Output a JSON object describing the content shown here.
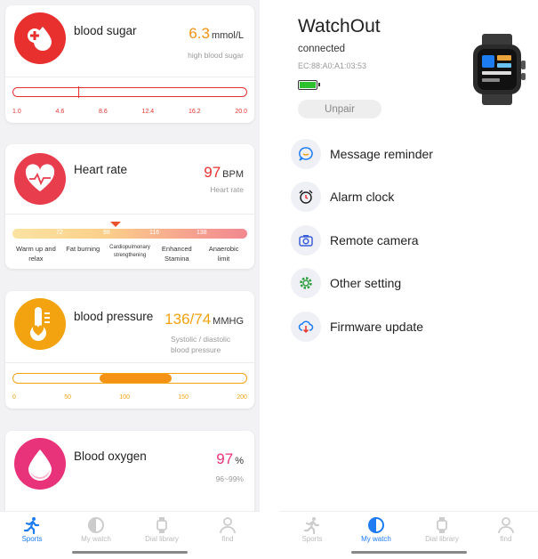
{
  "colors": {
    "sugar": "#e8312f",
    "heart": "#e83d4c",
    "pressure": "#f3a210",
    "oxygen": "#e8337a",
    "accent_blue": "#1e7cf2"
  },
  "left": {
    "blood_sugar": {
      "title": "blood sugar",
      "value": "6.3",
      "unit": "mmol/L",
      "status": "high blood sugar",
      "marker_fraction": 0.28,
      "ticks": [
        "1.0",
        "4.6",
        "8.6",
        "12.4",
        "16.2",
        "20.0"
      ]
    },
    "heart_rate": {
      "title": "Heart rate",
      "value": "97",
      "unit": "BPM",
      "sub": "Heart rate",
      "marker_fraction": 0.44,
      "scale_values": [
        "72",
        "98",
        "116",
        "138"
      ],
      "zones": [
        "Warm up and relax",
        "Fat burning",
        "Cardiopulmonary strengthening",
        "Enhanced Stamina",
        "Anaerobic limit"
      ]
    },
    "blood_pressure": {
      "title": "blood pressure",
      "value": "136/74",
      "unit": "MMHG",
      "sub_line1": "Systolic / diastolic",
      "sub_line2": "blood pressure",
      "range": [
        74,
        136
      ],
      "axis_max": 200,
      "ticks": [
        "0",
        "50",
        "100",
        "150",
        "200"
      ]
    },
    "blood_oxygen": {
      "title": "Blood oxygen",
      "value": "97",
      "unit": "%",
      "sub": "96~99%"
    },
    "tabs": [
      {
        "label": "Sports",
        "icon": "running-person-icon"
      },
      {
        "label": "My watch",
        "icon": "watch-face-icon"
      },
      {
        "label": "Dial library",
        "icon": "watch-icon"
      },
      {
        "label": "find",
        "icon": "person-icon"
      }
    ]
  },
  "right": {
    "device_name": "WatchOut",
    "status": "connected",
    "mac": "EC:88:A0:A1:03:53",
    "battery": "battery-full-icon",
    "unpair_label": "Unpair",
    "menu": [
      {
        "label": "Message reminder",
        "icon": "message-bubble-icon"
      },
      {
        "label": "Alarm clock",
        "icon": "alarm-clock-icon"
      },
      {
        "label": "Remote camera",
        "icon": "camera-icon"
      },
      {
        "label": "Other setting",
        "icon": "gear-icon"
      },
      {
        "label": "Firmware update",
        "icon": "cloud-download-icon"
      }
    ],
    "tabs": [
      {
        "label": "Sports",
        "icon": "running-person-icon"
      },
      {
        "label": "My watch",
        "icon": "watch-face-icon"
      },
      {
        "label": "Dial library",
        "icon": "watch-icon"
      },
      {
        "label": "find",
        "icon": "person-icon"
      }
    ]
  }
}
